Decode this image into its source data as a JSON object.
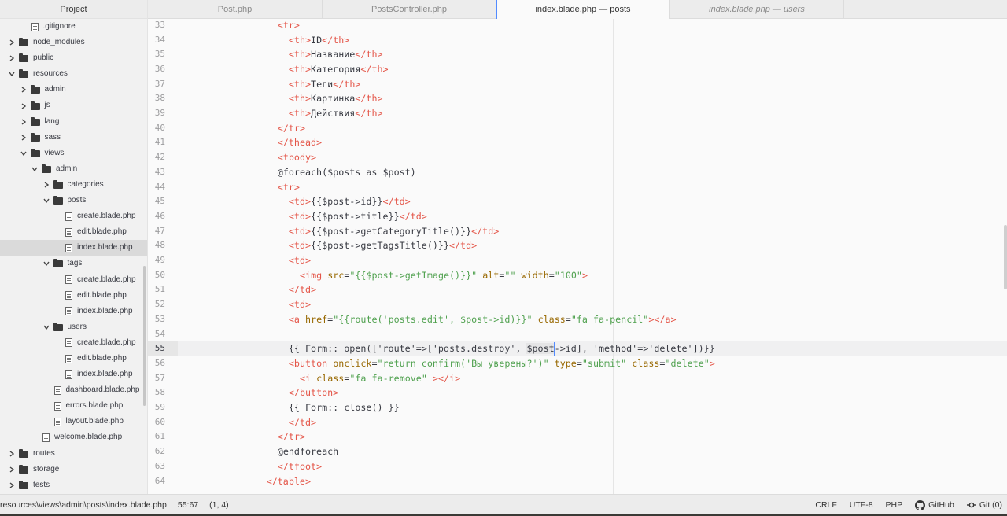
{
  "sidebar": {
    "title": "Project",
    "tree": [
      {
        "label": ".gitignore",
        "kind": "file",
        "depth": 2,
        "expanded": null
      },
      {
        "label": "node_modules",
        "kind": "folder",
        "depth": 1,
        "expanded": false
      },
      {
        "label": "public",
        "kind": "folder",
        "depth": 1,
        "expanded": false
      },
      {
        "label": "resources",
        "kind": "folder",
        "depth": 1,
        "expanded": true
      },
      {
        "label": "admin",
        "kind": "folder",
        "depth": 2,
        "expanded": false
      },
      {
        "label": "js",
        "kind": "folder",
        "depth": 2,
        "expanded": false
      },
      {
        "label": "lang",
        "kind": "folder",
        "depth": 2,
        "expanded": false
      },
      {
        "label": "sass",
        "kind": "folder",
        "depth": 2,
        "expanded": false
      },
      {
        "label": "views",
        "kind": "folder",
        "depth": 2,
        "expanded": true
      },
      {
        "label": "admin",
        "kind": "folder",
        "depth": 3,
        "expanded": true
      },
      {
        "label": "categories",
        "kind": "folder",
        "depth": 4,
        "expanded": false
      },
      {
        "label": "posts",
        "kind": "folder",
        "depth": 4,
        "expanded": true
      },
      {
        "label": "create.blade.php",
        "kind": "file",
        "depth": 5,
        "expanded": null
      },
      {
        "label": "edit.blade.php",
        "kind": "file",
        "depth": 5,
        "expanded": null
      },
      {
        "label": "index.blade.php",
        "kind": "file",
        "depth": 5,
        "expanded": null,
        "selected": true
      },
      {
        "label": "tags",
        "kind": "folder",
        "depth": 4,
        "expanded": true
      },
      {
        "label": "create.blade.php",
        "kind": "file",
        "depth": 5,
        "expanded": null
      },
      {
        "label": "edit.blade.php",
        "kind": "file",
        "depth": 5,
        "expanded": null
      },
      {
        "label": "index.blade.php",
        "kind": "file",
        "depth": 5,
        "expanded": null
      },
      {
        "label": "users",
        "kind": "folder",
        "depth": 4,
        "expanded": true
      },
      {
        "label": "create.blade.php",
        "kind": "file",
        "depth": 5,
        "expanded": null
      },
      {
        "label": "edit.blade.php",
        "kind": "file",
        "depth": 5,
        "expanded": null
      },
      {
        "label": "index.blade.php",
        "kind": "file",
        "depth": 5,
        "expanded": null
      },
      {
        "label": "dashboard.blade.php",
        "kind": "file",
        "depth": 4,
        "expanded": null
      },
      {
        "label": "errors.blade.php",
        "kind": "file",
        "depth": 4,
        "expanded": null
      },
      {
        "label": "layout.blade.php",
        "kind": "file",
        "depth": 4,
        "expanded": null
      },
      {
        "label": "welcome.blade.php",
        "kind": "file",
        "depth": 3,
        "expanded": null
      },
      {
        "label": "routes",
        "kind": "folder",
        "depth": 1,
        "expanded": false
      },
      {
        "label": "storage",
        "kind": "folder",
        "depth": 1,
        "expanded": false
      },
      {
        "label": "tests",
        "kind": "folder",
        "depth": 1,
        "expanded": false
      }
    ]
  },
  "tabs": [
    {
      "label": "Post.php",
      "active": false,
      "italic": false
    },
    {
      "label": "PostsController.php",
      "active": false,
      "italic": false
    },
    {
      "label": "index.blade.php — posts",
      "active": true,
      "italic": false
    },
    {
      "label": "index.blade.php — users",
      "active": false,
      "italic": true
    }
  ],
  "editor": {
    "current_line": 55,
    "lines": [
      {
        "n": 33,
        "indent": 8,
        "seg": [
          [
            "tag",
            "<tr>"
          ]
        ]
      },
      {
        "n": 34,
        "indent": 9,
        "seg": [
          [
            "tag",
            "<th>"
          ],
          [
            "txt",
            "ID"
          ],
          [
            "tag",
            "</th>"
          ]
        ]
      },
      {
        "n": 35,
        "indent": 9,
        "seg": [
          [
            "tag",
            "<th>"
          ],
          [
            "txt",
            "Название"
          ],
          [
            "tag",
            "</th>"
          ]
        ]
      },
      {
        "n": 36,
        "indent": 9,
        "seg": [
          [
            "tag",
            "<th>"
          ],
          [
            "txt",
            "Категория"
          ],
          [
            "tag",
            "</th>"
          ]
        ]
      },
      {
        "n": 37,
        "indent": 9,
        "seg": [
          [
            "tag",
            "<th>"
          ],
          [
            "txt",
            "Теги"
          ],
          [
            "tag",
            "</th>"
          ]
        ]
      },
      {
        "n": 38,
        "indent": 9,
        "seg": [
          [
            "tag",
            "<th>"
          ],
          [
            "txt",
            "Картинка"
          ],
          [
            "tag",
            "</th>"
          ]
        ]
      },
      {
        "n": 39,
        "indent": 9,
        "seg": [
          [
            "tag",
            "<th>"
          ],
          [
            "txt",
            "Действия"
          ],
          [
            "tag",
            "</th>"
          ]
        ]
      },
      {
        "n": 40,
        "indent": 8,
        "seg": [
          [
            "tag",
            "</tr>"
          ]
        ]
      },
      {
        "n": 41,
        "indent": 8,
        "seg": [
          [
            "tag",
            "</thead>"
          ]
        ]
      },
      {
        "n": 42,
        "indent": 8,
        "seg": [
          [
            "tag",
            "<tbody>"
          ]
        ]
      },
      {
        "n": 43,
        "indent": 8,
        "seg": [
          [
            "txt",
            "@foreach($posts as $post)"
          ]
        ]
      },
      {
        "n": 44,
        "indent": 8,
        "seg": [
          [
            "tag",
            "<tr>"
          ]
        ]
      },
      {
        "n": 45,
        "indent": 9,
        "seg": [
          [
            "tag",
            "<td>"
          ],
          [
            "txt",
            "{{$post->id}}"
          ],
          [
            "tag",
            "</td>"
          ]
        ]
      },
      {
        "n": 46,
        "indent": 9,
        "seg": [
          [
            "tag",
            "<td>"
          ],
          [
            "txt",
            "{{$post->title}}"
          ],
          [
            "tag",
            "</td>"
          ]
        ]
      },
      {
        "n": 47,
        "indent": 9,
        "seg": [
          [
            "tag",
            "<td>"
          ],
          [
            "txt",
            "{{$post->getCategoryTitle()}}"
          ],
          [
            "tag",
            "</td>"
          ]
        ]
      },
      {
        "n": 48,
        "indent": 9,
        "seg": [
          [
            "tag",
            "<td>"
          ],
          [
            "txt",
            "{{$post->getTagsTitle()}}"
          ],
          [
            "tag",
            "</td>"
          ]
        ]
      },
      {
        "n": 49,
        "indent": 9,
        "seg": [
          [
            "tag",
            "<td>"
          ]
        ]
      },
      {
        "n": 50,
        "indent": 10,
        "seg": [
          [
            "tag",
            "<img "
          ],
          [
            "attr",
            "src"
          ],
          [
            "txt",
            "="
          ],
          [
            "str",
            "\"{{$post->getImage()}}\""
          ],
          [
            "txt",
            " "
          ],
          [
            "attr",
            "alt"
          ],
          [
            "txt",
            "="
          ],
          [
            "str",
            "\"\""
          ],
          [
            "txt",
            " "
          ],
          [
            "attr",
            "width"
          ],
          [
            "txt",
            "="
          ],
          [
            "str",
            "\"100\""
          ],
          [
            "tag",
            ">"
          ]
        ]
      },
      {
        "n": 51,
        "indent": 9,
        "seg": [
          [
            "tag",
            "</td>"
          ]
        ]
      },
      {
        "n": 52,
        "indent": 9,
        "seg": [
          [
            "tag",
            "<td>"
          ]
        ]
      },
      {
        "n": 53,
        "indent": 9,
        "seg": [
          [
            "tag",
            "<a "
          ],
          [
            "attr",
            "href"
          ],
          [
            "txt",
            "="
          ],
          [
            "str",
            "\"{{route('posts.edit', $post->id)}}\""
          ],
          [
            "txt",
            " "
          ],
          [
            "attr",
            "class"
          ],
          [
            "txt",
            "="
          ],
          [
            "str",
            "\"fa fa-pencil\""
          ],
          [
            "tag",
            "></a>"
          ]
        ]
      },
      {
        "n": 54,
        "indent": 0,
        "seg": []
      },
      {
        "n": 55,
        "indent": 9,
        "seg": [
          [
            "txt",
            "{{ Form:: open(['route'=>['posts.destroy', "
          ],
          [
            "sel",
            "$post"
          ],
          [
            "txt",
            "->id], 'method'=>'delete'])}}"
          ]
        ]
      },
      {
        "n": 56,
        "indent": 9,
        "seg": [
          [
            "tag",
            "<button "
          ],
          [
            "attr",
            "onclick"
          ],
          [
            "txt",
            "="
          ],
          [
            "str",
            "\"return confirm('Вы уверены?')\""
          ],
          [
            "txt",
            " "
          ],
          [
            "attr",
            "type"
          ],
          [
            "txt",
            "="
          ],
          [
            "str",
            "\"submit\""
          ],
          [
            "txt",
            " "
          ],
          [
            "attr",
            "class"
          ],
          [
            "txt",
            "="
          ],
          [
            "str",
            "\"delete\""
          ],
          [
            "tag",
            ">"
          ]
        ]
      },
      {
        "n": 57,
        "indent": 10,
        "seg": [
          [
            "tag",
            "<i "
          ],
          [
            "attr",
            "class"
          ],
          [
            "txt",
            "="
          ],
          [
            "str",
            "\"fa fa-remove\""
          ],
          [
            "txt",
            " "
          ],
          [
            "tag",
            "></i>"
          ]
        ]
      },
      {
        "n": 58,
        "indent": 9,
        "seg": [
          [
            "tag",
            "</button>"
          ]
        ]
      },
      {
        "n": 59,
        "indent": 9,
        "seg": [
          [
            "txt",
            "{{ Form:: close() }}"
          ]
        ]
      },
      {
        "n": 60,
        "indent": 9,
        "seg": [
          [
            "tag",
            "</td>"
          ]
        ]
      },
      {
        "n": 61,
        "indent": 8,
        "seg": [
          [
            "tag",
            "</tr>"
          ]
        ]
      },
      {
        "n": 62,
        "indent": 8,
        "seg": [
          [
            "txt",
            "@endforeach"
          ]
        ]
      },
      {
        "n": 63,
        "indent": 8,
        "seg": [
          [
            "tag",
            "</tfoot>"
          ]
        ]
      },
      {
        "n": 64,
        "indent": 7,
        "seg": [
          [
            "tag",
            "</table>"
          ]
        ]
      }
    ]
  },
  "status": {
    "path": "resources\\views\\admin\\posts\\index.blade.php",
    "cursor": "55:67",
    "selection": "(1, 4)",
    "line_ending": "CRLF",
    "encoding": "UTF-8",
    "grammar": "PHP",
    "github": "GitHub",
    "git": "Git (0)"
  },
  "colors": {
    "accent": "#528bff",
    "tag": "#e45649",
    "attr": "#986801",
    "string": "#50a14f"
  }
}
